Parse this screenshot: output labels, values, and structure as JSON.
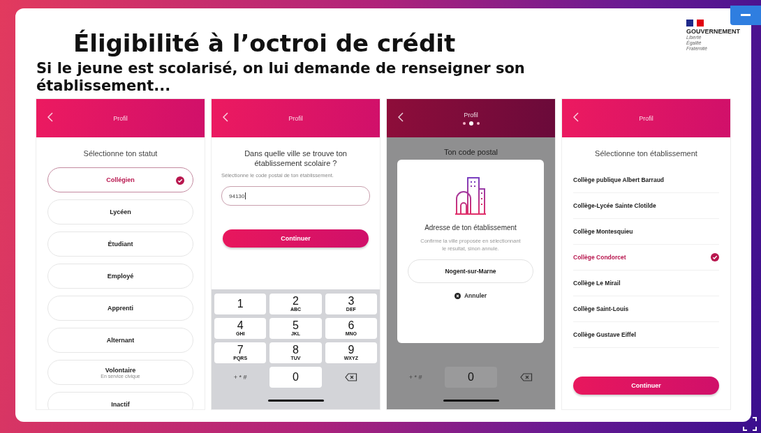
{
  "slide": {
    "title": "Éligibilité à l’octroi de crédit",
    "subtitle": "Si le jeune est scolarisé, on lui demande de renseigner son établissement...",
    "logo": {
      "name": "GOUVERNEMENT",
      "motto": [
        "Liberté",
        "Égalité",
        "Fraternité"
      ]
    }
  },
  "screens": [
    {
      "kind": "status",
      "header": "Profil",
      "heading": "Sélectionne ton statut",
      "options": [
        {
          "label": "Collégien",
          "selected": true
        },
        {
          "label": "Lycéen",
          "selected": false
        },
        {
          "label": "Étudiant",
          "selected": false
        },
        {
          "label": "Employé",
          "selected": false
        },
        {
          "label": "Apprenti",
          "selected": false
        },
        {
          "label": "Alternant",
          "selected": false
        },
        {
          "label": "Volontaire",
          "sublabel": "En service civique",
          "selected": false
        },
        {
          "label": "Inactif",
          "selected": false
        }
      ]
    },
    {
      "kind": "postal",
      "header": "Profil",
      "question": "Dans quelle ville se trouve ton établissement scolaire ?",
      "hint": "Sélectionne le code postal de ton établissement.",
      "value": "94130",
      "button": "Continuer",
      "keys": [
        {
          "digit": "1"
        },
        {
          "digit": "2",
          "letters": "ABC"
        },
        {
          "digit": "3",
          "letters": "DEF"
        },
        {
          "digit": "4",
          "letters": "GHI"
        },
        {
          "digit": "5",
          "letters": "JKL"
        },
        {
          "digit": "6",
          "letters": "MNO"
        },
        {
          "digit": "7",
          "letters": "PQRS"
        },
        {
          "digit": "8",
          "letters": "TUV"
        },
        {
          "digit": "9",
          "letters": "WXYZ"
        }
      ],
      "symbols": "+ * #",
      "zero": "0"
    },
    {
      "kind": "modal",
      "header": "Profil",
      "pager": [
        {
          "selected": false
        },
        {
          "selected": true
        },
        {
          "selected": false
        }
      ],
      "behind": "Ton code postal",
      "modal_title": "Adresse de ton établissement",
      "modal_text": "Confirme la ville proposée en sélectionnant le résultat, sinon annule.",
      "option": "Nogent-sur-Marne",
      "cancel": "Annuler",
      "symbols": "+ * #",
      "zero": "0"
    },
    {
      "kind": "schools",
      "header": "Profil",
      "heading": "Sélectionne ton établissement",
      "items": [
        {
          "label": "Collège publique Albert Barraud",
          "selected": false
        },
        {
          "label": "Collège-Lycée Sainte Clotilde",
          "selected": false
        },
        {
          "label": "Collège Montesquieu",
          "selected": false
        },
        {
          "label": "Collège Condorcet",
          "selected": true
        },
        {
          "label": "Collège Le Mirail",
          "selected": false
        },
        {
          "label": "Collège Saint-Louis",
          "selected": false
        },
        {
          "label": "Collège Gustave Eiffel",
          "selected": false
        }
      ],
      "button": "Continuer"
    }
  ]
}
